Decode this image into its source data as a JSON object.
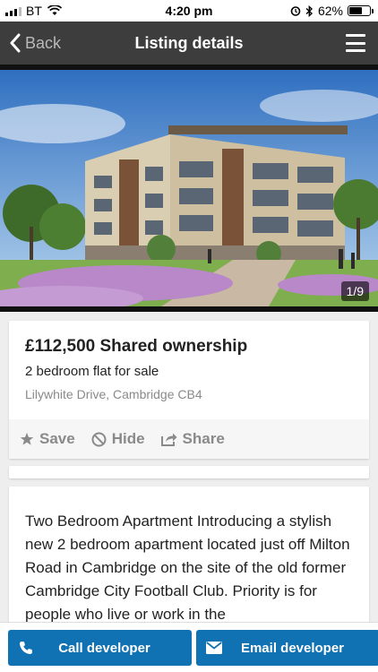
{
  "status_bar": {
    "carrier": "BT",
    "time": "4:20 pm",
    "battery": "62%",
    "battery_level": 0.62
  },
  "nav": {
    "back_label": "Back",
    "title": "Listing details"
  },
  "hero": {
    "counter": "1/9"
  },
  "listing": {
    "price_line": "£112,500 Shared ownership",
    "subtitle": "2 bedroom flat for sale",
    "address": "Lilywhite Drive, Cambridge CB4"
  },
  "actions": {
    "save": "Save",
    "hide": "Hide",
    "share": "Share"
  },
  "description": "Two Bedroom Apartment Introducing a stylish new 2 bedroom apartment located just off Milton Road in Cambridge on the site of the old former Cambridge City Football Club. Priority is for people who live or work in the",
  "buttons": {
    "call": "Call developer",
    "email": "Email developer"
  },
  "colors": {
    "nav_bg": "#3d3d3d",
    "button_bg": "#1172b3",
    "muted_text": "#8a8a8a"
  },
  "icons": [
    "signal-icon",
    "wifi-icon",
    "alarm-icon",
    "bluetooth-icon",
    "battery-icon",
    "back-chevron-icon",
    "menu-icon",
    "star-icon",
    "hide-icon",
    "share-icon",
    "phone-icon",
    "envelope-icon"
  ]
}
